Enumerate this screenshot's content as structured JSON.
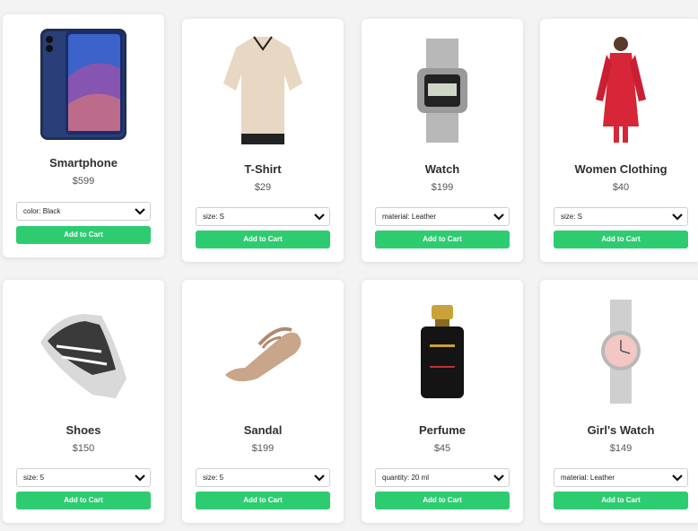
{
  "accent_color": "#2ecc71",
  "products": [
    {
      "name": "Smartphone",
      "price": "$599",
      "option": "color: Black",
      "button": "Add to Cart",
      "icon": "smartphone-image"
    },
    {
      "name": "T-Shirt",
      "price": "$29",
      "option": "size: S",
      "button": "Add to Cart",
      "icon": "tshirt-image"
    },
    {
      "name": "Watch",
      "price": "$199",
      "option": "material: Leather",
      "button": "Add to Cart",
      "icon": "watch-image"
    },
    {
      "name": "Women Clothing",
      "price": "$40",
      "option": "size: S",
      "button": "Add to Cart",
      "icon": "women-clothing-image"
    },
    {
      "name": "Shoes",
      "price": "$150",
      "option": "size: 5",
      "button": "Add to Cart",
      "icon": "shoes-image"
    },
    {
      "name": "Sandal",
      "price": "$199",
      "option": "size: 5",
      "button": "Add to Cart",
      "icon": "sandal-image"
    },
    {
      "name": "Perfume",
      "price": "$45",
      "option": "quantity: 20 ml",
      "button": "Add to Cart",
      "icon": "perfume-image"
    },
    {
      "name": "Girl's Watch",
      "price": "$149",
      "option": "material: Leather",
      "button": "Add to Cart",
      "icon": "girls-watch-image"
    }
  ]
}
